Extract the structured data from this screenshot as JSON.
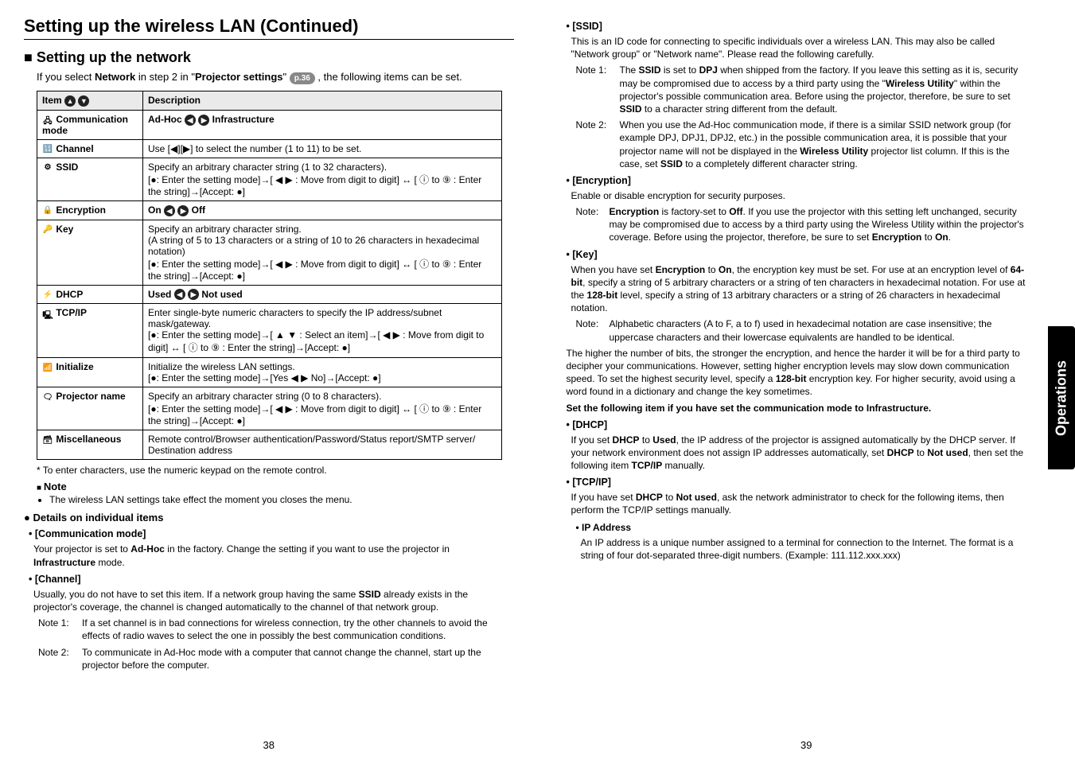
{
  "left": {
    "title": "Setting up the wireless LAN (Continued)",
    "subtitle": "Setting up the network",
    "intro_pre": "If you select ",
    "intro_bold1": "Network",
    "intro_mid": " in step 2 in \"",
    "intro_bold2": "Projector settings",
    "intro_post": "\" ",
    "pageref": "p.36",
    "intro_end": " , the following items can be set.",
    "table_header_item": "Item",
    "table_header_desc": "Description",
    "rows": [
      {
        "item": "Communication mode",
        "desc_pre": "Ad-Hoc ",
        "desc_post": " Infrastructure"
      },
      {
        "item": "Channel",
        "desc": "Use [◀][▶] to select the number (1 to 11) to be set."
      },
      {
        "item": "SSID",
        "desc": "Specify an arbitrary character string (1 to 32 characters).\n[●: Enter the setting mode]→[ ◀ ▶ : Move from digit to digit] ↔ [ ⓘ to ⑨ : Enter the string]→[Accept: ●]"
      },
      {
        "item": "Encryption",
        "desc_pre": "On ",
        "desc_post": " Off"
      },
      {
        "item": "Key",
        "desc": "Specify an arbitrary character string.\n(A string of 5 to 13 characters or a string of 10 to 26 characters in hexadecimal notation)\n[●: Enter the setting mode]→[ ◀ ▶ : Move from digit to digit] ↔ [ ⓘ to ⑨ : Enter the string]→[Accept: ●]"
      },
      {
        "item": "DHCP",
        "desc_pre": "Used ",
        "desc_post": " Not used"
      },
      {
        "item": "TCP/IP",
        "desc": "Enter single-byte numeric characters to specify the IP address/subnet mask/gateway.\n[●: Enter the setting mode]→[ ▲ ▼ : Select an item]→[ ◀ ▶ : Move from digit to digit] ↔ [ ⓘ to ⑨ : Enter the string]→[Accept: ●]"
      },
      {
        "item": "Initialize",
        "desc": "Initialize the wireless LAN settings.\n[●: Enter the setting mode]→[Yes ◀ ▶ No]→[Accept: ●]"
      },
      {
        "item": "Projector name",
        "desc": "Specify an arbitrary character string (0 to 8 characters).\n[●: Enter the setting mode]→[ ◀ ▶ : Move from digit to digit] ↔ [ ⓘ to ⑨ : Enter the string]→[Accept: ●]"
      },
      {
        "item": "Miscellaneous",
        "desc": "Remote control/Browser authentication/Password/Status report/SMTP server/ Destination address"
      }
    ],
    "footnote": "* To enter characters, use the numeric keypad on the remote control.",
    "note_head": "Note",
    "note_bullet": "The wireless LAN settings take effect the moment you closes the menu.",
    "details_head": "Details on individual items",
    "comm_head": "[Communication mode]",
    "comm_body_pre": "Your projector is set to ",
    "comm_body_b1": "Ad-Hoc",
    "comm_body_mid": " in the factory. Change the setting if you want to use the projector in ",
    "comm_body_b2": "Infrastructure",
    "comm_body_post": " mode.",
    "channel_head": "[Channel]",
    "channel_body_pre": "Usually, you do not have to set this item. If a network group having the same ",
    "channel_body_b": "SSID",
    "channel_body_post": " already exists in the projector's coverage, the channel is changed automatically to the channel of that network group.",
    "note1_label": "Note 1:",
    "note1_text": "If a set channel is in bad connections for wireless connection, try the other channels to avoid the effects of radio waves to select the one in possibly the best communication conditions.",
    "note2_label": "Note 2:",
    "note2_text": "To communicate in Ad-Hoc mode with a computer that cannot change the channel, start up the projector before the computer.",
    "pagenum": "38"
  },
  "right": {
    "ssid_head": "[SSID]",
    "ssid_body": "This is an ID code for connecting to specific individuals over a wireless LAN.  This may also be called \"Network group\" or \"Network name\".  Please read the following carefully.",
    "ssid_n1_label": "Note 1:",
    "ssid_n1_pre": "The ",
    "ssid_n1_b1": "SSID",
    "ssid_n1_m1": " is set to ",
    "ssid_n1_b2": "DPJ",
    "ssid_n1_m2": " when shipped from the factory. If you leave this setting as it is, security may be compromised due to access by a third party using the \"",
    "ssid_n1_b3": "Wireless Utility",
    "ssid_n1_m3": "\" within the projector's possible communication area. Before using the projector, therefore, be sure to set ",
    "ssid_n1_b4": "SSID",
    "ssid_n1_m4": " to a character string different from the default.",
    "ssid_n2_label": "Note 2:",
    "ssid_n2_pre": "When you use the Ad-Hoc communication mode, if there is a similar SSID network group (for example DPJ, DPJ1, DPJ2, etc.) in the possible communication area, it is possible that your projector name will not be displayed in the ",
    "ssid_n2_b1": "Wireless Utility",
    "ssid_n2_m1": " projector list column. If this is the case, set ",
    "ssid_n2_b2": "SSID",
    "ssid_n2_m2": " to a completely different character string.",
    "enc_head": "[Encryption]",
    "enc_body": "Enable or disable encryption for security purposes.",
    "enc_note_label": "Note:",
    "enc_note_b1": "Encryption",
    "enc_note_m1": " is factory-set to ",
    "enc_note_b2": "Off",
    "enc_note_m2": ". If you use the projector with this setting left unchanged, security may be compromised due to access by a third party using the Wireless Utility within the projector's coverage. Before using the projector, therefore, be sure to set ",
    "enc_note_b3": "Encryption",
    "enc_note_m3": " to ",
    "enc_note_b4": "On",
    "enc_note_m4": ".",
    "key_head": "[Key]",
    "key_body_pre": "When you have set ",
    "key_body_b1": "Encryption",
    "key_body_m1": " to ",
    "key_body_b2": "On",
    "key_body_m2": ", the encryption key must be set. For use at an encryption level of ",
    "key_body_b3": "64-bit",
    "key_body_m3": ", specify a string of 5 arbitrary characters or a string of ten characters in hexadecimal notation. For use at the ",
    "key_body_b4": "128-bit",
    "key_body_m4": " level, specify a string of 13 arbitrary characters or a string of 26 characters in hexadecimal notation.",
    "key_note_label": "Note:",
    "key_note_text": "Alphabetic characters (A to F, a to f) used in hexadecimal notation are case insensitive; the uppercase characters and their lowercase equivalents are handled to be identical.",
    "para1_pre": "The higher the number of bits, the stronger the encryption, and hence the harder it will be for a third party to decipher your communications. However, setting higher encryption levels may slow down communication speed. To set the highest security level, specify a ",
    "para1_b": "128-bit",
    "para1_post": " encryption key. For higher security, avoid using a word found in a dictionary and change the key sometimes.",
    "para2": "Set the following item if you have set the communication mode to Infrastructure.",
    "dhcp_head": "[DHCP]",
    "dhcp_pre": "If you set ",
    "dhcp_b1": "DHCP",
    "dhcp_m1": " to ",
    "dhcp_b2": "Used",
    "dhcp_m2": ", the IP address of the projector is assigned automatically by the DHCP server. If your network environment does not assign IP addresses automatically, set ",
    "dhcp_b3": "DHCP",
    "dhcp_m3": " to ",
    "dhcp_b4": "Not used",
    "dhcp_m4": ", then set the following item ",
    "dhcp_b5": "TCP/IP",
    "dhcp_m5": " manually.",
    "tcp_head": "[TCP/IP]",
    "tcp_pre": "If you have set ",
    "tcp_b1": "DHCP",
    "tcp_m1": " to ",
    "tcp_b2": "Not used",
    "tcp_m2": ", ask the network administrator to check for the following items, then perform the TCP/IP settings manually.",
    "ip_head": "IP Address",
    "ip_body": "An IP address is a unique number assigned to a terminal for connection to the Internet. The format is a string of four dot-separated three-digit numbers. (Example: 111.112.xxx.xxx)",
    "pagenum": "39",
    "tab": "Operations"
  }
}
